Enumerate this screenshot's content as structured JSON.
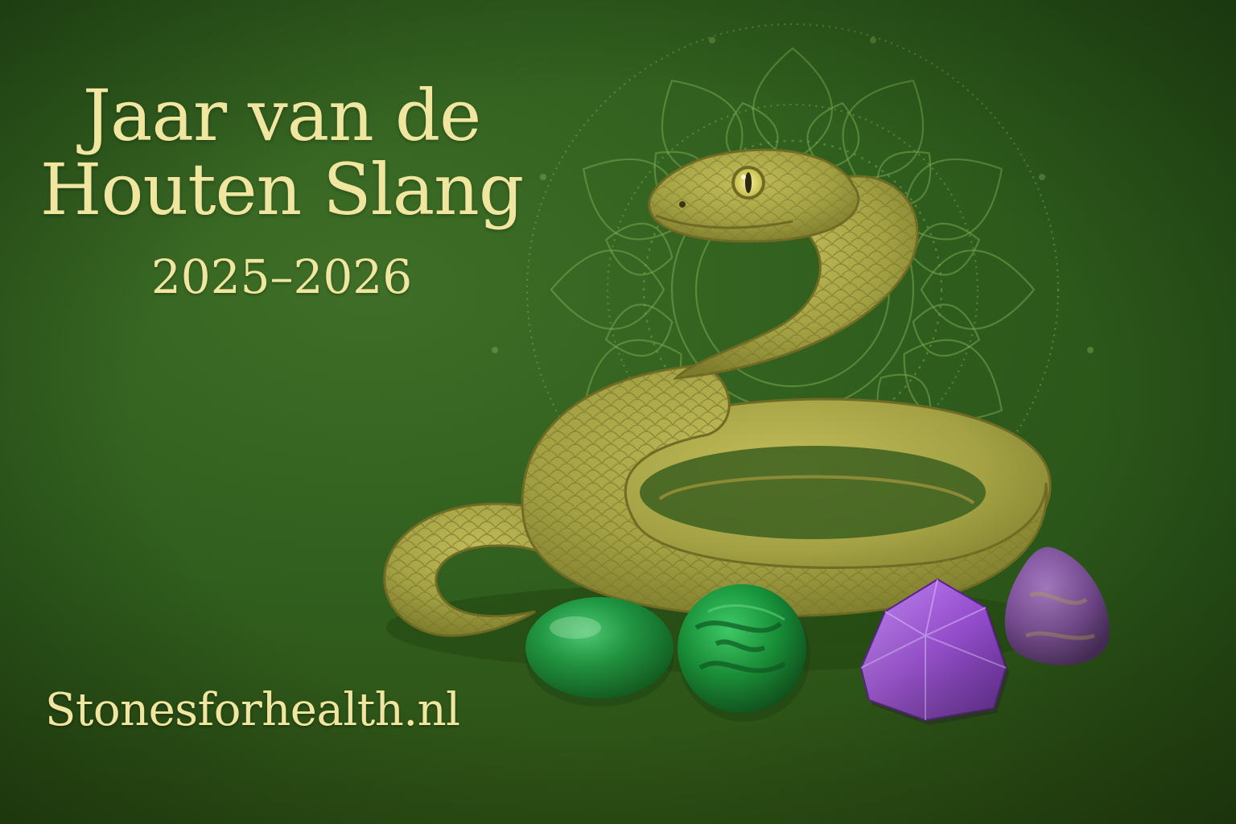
{
  "poster": {
    "title_line_1": "Jaar van de",
    "title_line_2": "Houten Slang",
    "years": "2025–2026",
    "website": "Stonesforhealth.nl"
  },
  "colors": {
    "background": "#2f5d1d",
    "text": "#f0e6a0",
    "snake": "#a8a848",
    "mandala": "#6f9a44",
    "green_stone": "#1f8a3a",
    "malachite": "#1e9a3c",
    "amethyst": "#9a4fd0",
    "purple_stone": "#7a4fa0"
  },
  "illustration": {
    "subject": "coiled wood snake",
    "background_ornament": "mandala",
    "stones": [
      "green-tumbled-stone",
      "malachite-sphere",
      "amethyst-point",
      "purple-tumbled-stone"
    ]
  }
}
